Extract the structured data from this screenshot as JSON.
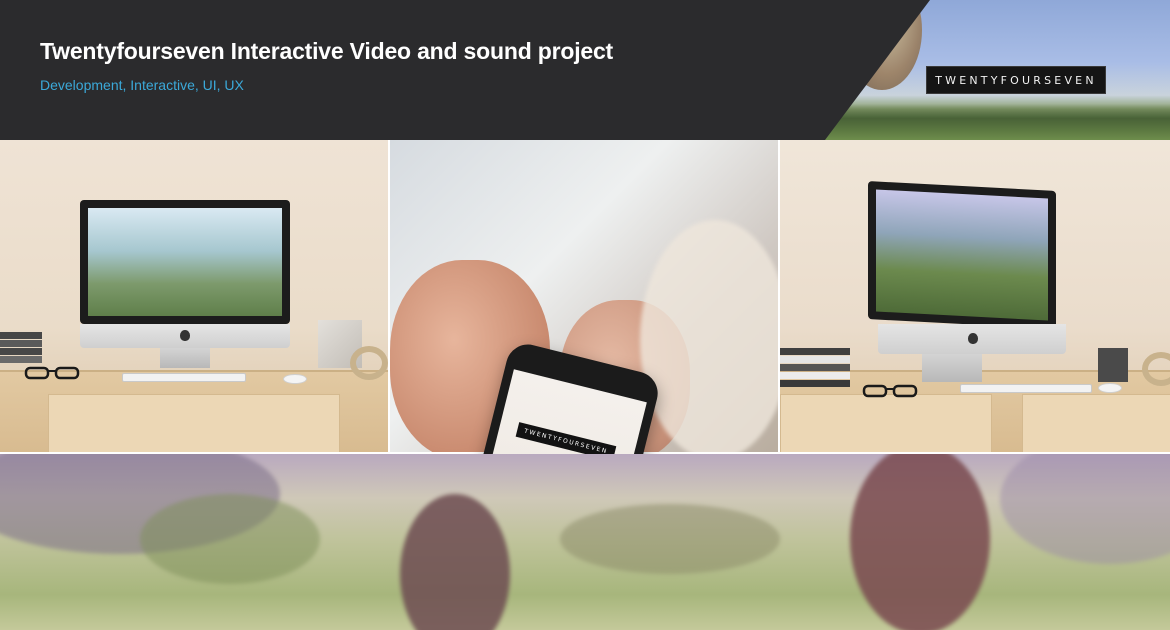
{
  "header": {
    "title": "Twentyfourseven Interactive Video and sound project",
    "tags": "Development, Interactive, UI, UX",
    "brand_logo": "TWENTYFOURSEVEN"
  },
  "gallery": {
    "phone_logo": "TWENTYFOURSEVEN"
  },
  "colors": {
    "header_bg": "#2b2b2d",
    "title": "#ffffff",
    "tags": "#3ba9d9"
  }
}
